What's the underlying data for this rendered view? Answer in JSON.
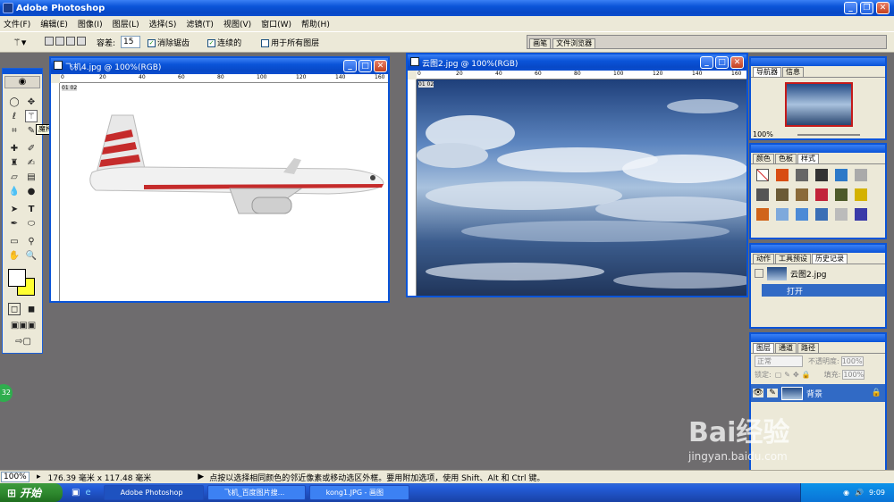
{
  "app": {
    "title": "Adobe Photoshop"
  },
  "menu": [
    "文件(F)",
    "编辑(E)",
    "图像(I)",
    "图层(L)",
    "选择(S)",
    "滤镜(T)",
    "视图(V)",
    "窗口(W)",
    "帮助(H)"
  ],
  "options": {
    "tolerance_label": "容差:",
    "tolerance_value": "15",
    "antialias": "消除锯齿",
    "contiguous": "连续的",
    "all_layers": "用于所有图层"
  },
  "palette_well": {
    "brushes": "画笔",
    "file_browser": "文件浏览器"
  },
  "tooltip": "魔棒工具 (W)",
  "documents": [
    {
      "title": "飞机4.jpg @ 100%(RGB)",
      "ruler_h": [
        "0",
        "20",
        "40",
        "60",
        "80",
        "100",
        "120",
        "140",
        "160"
      ],
      "ruler_v": [
        "0",
        "2",
        "4",
        "6",
        "8"
      ],
      "tag": "01 02"
    },
    {
      "title": "云图2.jpg @ 100%(RGB)",
      "ruler_h": [
        "0",
        "20",
        "40",
        "60",
        "80",
        "100",
        "120",
        "140",
        "160"
      ],
      "ruler_v": [
        "0",
        "2",
        "4",
        "6",
        "8"
      ],
      "tag": "01 02"
    }
  ],
  "navigator": {
    "tabs": [
      "导航器",
      "信息"
    ],
    "zoom": "100%"
  },
  "swatches": {
    "tabs": [
      "颜色",
      "色板",
      "样式"
    ]
  },
  "history": {
    "tabs": [
      "动作",
      "工具预设",
      "历史记录"
    ],
    "snapshot": "云图2.jpg",
    "step": "打开"
  },
  "layers": {
    "tabs": [
      "图层",
      "通道",
      "路径"
    ],
    "blend": "正常",
    "opacity_label": "不透明度:",
    "opacity": "100%",
    "lock_label": "锁定:",
    "fill_label": "填充:",
    "fill": "100%",
    "layer_name": "背景"
  },
  "status": {
    "zoom": "100%",
    "doc_size": "176.39 毫米 x 117.48 毫米",
    "hint": "点按以选择相同颜色的邻近像素或移动选区外框。要用附加选项，使用 Shift、Alt 和 Ctrl 键。"
  },
  "taskbar": {
    "start": "开始",
    "items": [
      "Adobe Photoshop",
      "飞机_百度图片搜...",
      "kong1.JPG - 画图"
    ],
    "time": "9:09"
  },
  "watermark": {
    "text": "Bai经验",
    "url": "jingyan.baidu.com"
  },
  "badge": "32"
}
